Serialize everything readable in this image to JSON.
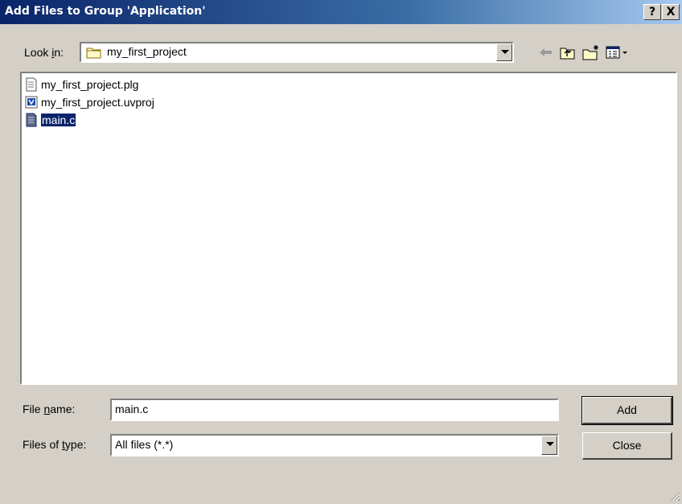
{
  "window": {
    "title": "Add Files to Group 'Application'",
    "help_label": "?",
    "close_label": "X"
  },
  "look_in": {
    "label_pre": "Look ",
    "label_accel": "i",
    "label_post": "n:",
    "value": "my_first_project",
    "icon": "folder-icon"
  },
  "toolbar": {
    "back_icon": "back-arrow-icon",
    "up_icon": "up-folder-icon",
    "new_folder_icon": "new-folder-icon",
    "view_menu_icon": "view-menu-icon"
  },
  "files": [
    {
      "name": "my_first_project.plg",
      "icon": "text-file-icon",
      "selected": false
    },
    {
      "name": "my_first_project.uvproj",
      "icon": "uvision-project-icon",
      "selected": false
    },
    {
      "name": "main.c",
      "icon": "c-source-file-icon",
      "selected": true
    }
  ],
  "file_name": {
    "label_pre": "File ",
    "label_accel": "n",
    "label_post": "ame:",
    "value": "main.c"
  },
  "file_type": {
    "label_pre": "Files of ",
    "label_accel": "t",
    "label_post": "ype:",
    "value": "All files (*.*)"
  },
  "buttons": {
    "add": "Add",
    "close": "Close"
  },
  "colors": {
    "title_bar": "#0a246a",
    "face": "#d4d0c8",
    "selection": "#0a246a"
  }
}
